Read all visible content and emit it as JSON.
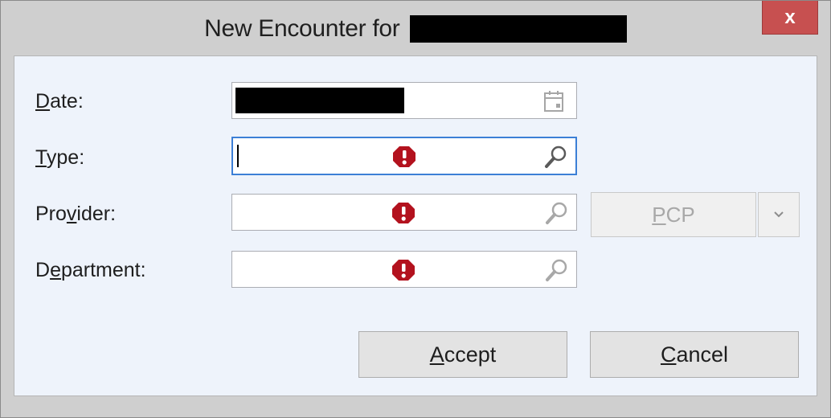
{
  "window": {
    "title": "New Encounter for",
    "close_label": "x"
  },
  "form": {
    "date": {
      "label_acc": "D",
      "label_rest": "ate:",
      "value": ""
    },
    "type": {
      "label_acc": "T",
      "label_rest": "ype:",
      "value": ""
    },
    "provider": {
      "label_pre": "Pro",
      "label_acc": "v",
      "label_rest": "ider:",
      "value": ""
    },
    "department": {
      "label_pre": "D",
      "label_acc": "e",
      "label_rest": "partment:",
      "value": ""
    }
  },
  "pcp": {
    "label_acc": "P",
    "label_rest": "CP"
  },
  "actions": {
    "accept_acc": "A",
    "accept_rest": "ccept",
    "cancel_acc": "C",
    "cancel_rest": "ancel"
  },
  "colors": {
    "error": "#b3121e",
    "focus": "#3c7fd6",
    "close": "#c75050"
  },
  "icons": [
    "calendar-icon",
    "error-icon",
    "magnifier-icon",
    "chevron-down-icon",
    "close-icon"
  ]
}
